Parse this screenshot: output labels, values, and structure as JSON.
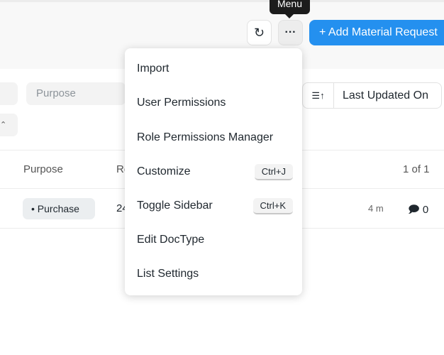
{
  "header": {
    "refresh_icon": "refresh-icon",
    "more_label": "···",
    "tooltip": "Menu",
    "add_label": "+ Add Material Request"
  },
  "filters": {
    "purpose_placeholder": "Purpose",
    "sort_icon": "sort-ascending-icon",
    "sort_label": "Last Updated On"
  },
  "list": {
    "columns": [
      "Purpose",
      "Re"
    ],
    "pagination": "1 of 1",
    "rows": [
      {
        "purpose": "Purchase",
        "value": "24",
        "time": "4 m",
        "comments": "0"
      }
    ]
  },
  "menu": {
    "items": [
      {
        "label": "Import"
      },
      {
        "label": "User Permissions"
      },
      {
        "label": "Role Permissions Manager"
      },
      {
        "label": "Customize",
        "shortcut": "Ctrl+J"
      },
      {
        "label": "Toggle Sidebar",
        "shortcut": "Ctrl+K"
      },
      {
        "label": "Edit DocType"
      },
      {
        "label": "List Settings"
      }
    ]
  },
  "colors": {
    "primary": "#2490ef"
  }
}
